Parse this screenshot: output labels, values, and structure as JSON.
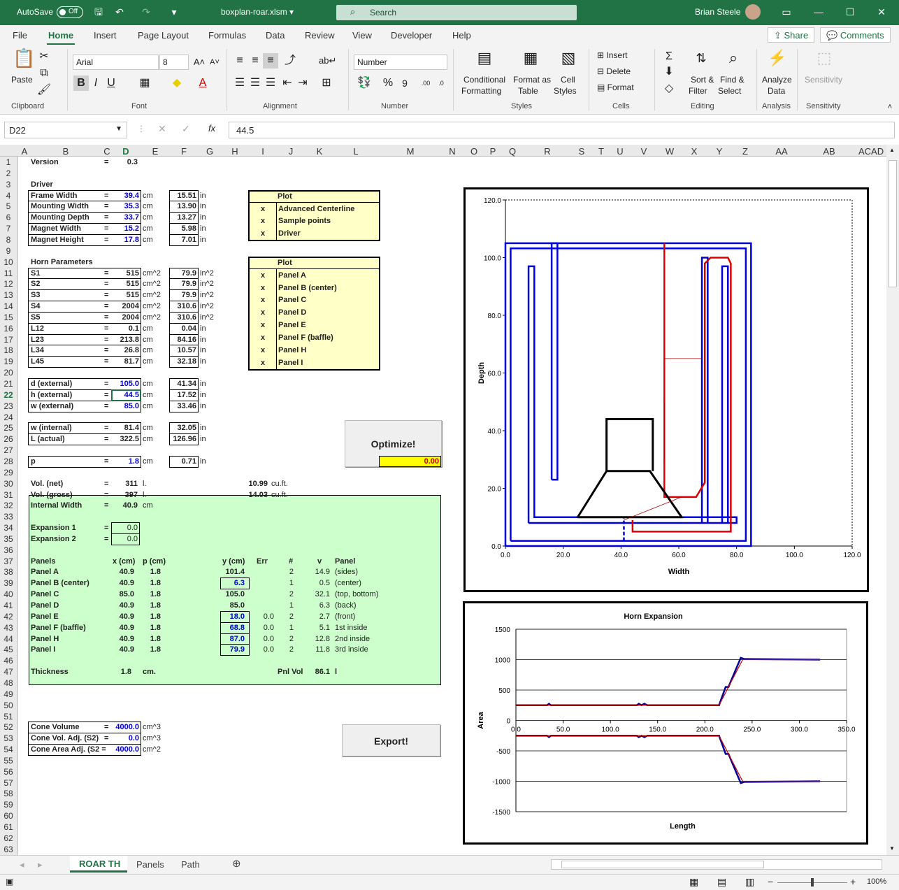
{
  "titlebar": {
    "autosave": "AutoSave",
    "autosave_state": "Off",
    "filename": "boxplan-roar.xlsm ▾",
    "search": "Search",
    "user": "Brian Steele"
  },
  "menu": {
    "tabs": [
      "File",
      "Home",
      "Insert",
      "Page Layout",
      "Formulas",
      "Data",
      "Review",
      "View",
      "Developer",
      "Help"
    ],
    "share": "Share",
    "comments": "Comments"
  },
  "ribbon": {
    "paste": "Paste",
    "font_name": "Arial",
    "font_size": "8",
    "number_format": "Number",
    "groups": [
      "Clipboard",
      "Font",
      "Alignment",
      "Number",
      "Styles",
      "Cells",
      "Editing",
      "Analysis",
      "Sensitivity"
    ],
    "conditional": "Conditional",
    "formatting": "Formatting",
    "format_as": "Format as",
    "table": "Table",
    "cell": "Cell",
    "styles": "Styles",
    "insert": "Insert",
    "delete": "Delete",
    "format": "Format",
    "sort_filter_1": "Sort &",
    "sort_filter_2": "Filter",
    "find_1": "Find &",
    "find_2": "Select",
    "analyze_1": "Analyze",
    "analyze_2": "Data",
    "sensitivity": "Sensitivity"
  },
  "formula_bar": {
    "name_box": "D22",
    "value": "44.5"
  },
  "columns": [
    "A",
    "B",
    "C",
    "D",
    "E",
    "F",
    "G",
    "H",
    "I",
    "J",
    "K",
    "L",
    "M",
    "N",
    "O",
    "P",
    "Q",
    "R",
    "S",
    "T",
    "U",
    "V",
    "W",
    "X",
    "Y",
    "Z",
    "AA",
    "AB",
    "ACAD"
  ],
  "rows": [
    "1",
    "2",
    "3",
    "4",
    "5",
    "6",
    "7",
    "8",
    "9",
    "10",
    "11",
    "12",
    "13",
    "14",
    "15",
    "16",
    "17",
    "18",
    "19",
    "20",
    "21",
    "22",
    "23",
    "24",
    "25",
    "26",
    "27",
    "28",
    "29",
    "30",
    "31",
    "32",
    "33",
    "34",
    "35",
    "36",
    "37",
    "38",
    "39",
    "40",
    "41",
    "42",
    "43",
    "44",
    "45",
    "46",
    "47",
    "48",
    "49",
    "50",
    "51",
    "52",
    "53",
    "54",
    "55",
    "56",
    "57",
    "58",
    "59",
    "60",
    "61",
    "62",
    "63"
  ],
  "sheet": {
    "version_label": "Version",
    "version_eq": "=",
    "version": "0.3",
    "driver": "Driver",
    "horn_params": "Horn Parameters",
    "params": [
      {
        "label": "Frame Width",
        "eq": "=",
        "v": "39.4",
        "u": "cm",
        "v2": "15.51",
        "u2": "in"
      },
      {
        "label": "Mounting Width",
        "eq": "=",
        "v": "35.3",
        "u": "cm",
        "v2": "13.90",
        "u2": "in"
      },
      {
        "label": "Mounting Depth",
        "eq": "=",
        "v": "33.7",
        "u": "cm",
        "v2": "13.27",
        "u2": "in"
      },
      {
        "label": "Magnet Width",
        "eq": "=",
        "v": "15.2",
        "u": "cm",
        "v2": "5.98",
        "u2": "in"
      },
      {
        "label": "Magnet Height",
        "eq": "=",
        "v": "17.8",
        "u": "cm",
        "v2": "7.01",
        "u2": "in"
      }
    ],
    "horn": [
      {
        "label": "S1",
        "eq": "=",
        "v": "515",
        "u": "cm^2",
        "v2": "79.9",
        "u2": "in^2"
      },
      {
        "label": "S2",
        "eq": "=",
        "v": "515",
        "u": "cm^2",
        "v2": "79.9",
        "u2": "in^2"
      },
      {
        "label": "S3",
        "eq": "=",
        "v": "515",
        "u": "cm^2",
        "v2": "79.9",
        "u2": "in^2"
      },
      {
        "label": "S4",
        "eq": "=",
        "v": "2004",
        "u": "cm^2",
        "v2": "310.6",
        "u2": "in^2"
      },
      {
        "label": "S5",
        "eq": "=",
        "v": "2004",
        "u": "cm^2",
        "v2": "310.6",
        "u2": "in^2"
      },
      {
        "label": "L12",
        "eq": "=",
        "v": "0.1",
        "u": "cm",
        "v2": "0.04",
        "u2": "in"
      },
      {
        "label": "L23",
        "eq": "=",
        "v": "213.8",
        "u": "cm",
        "v2": "84.16",
        "u2": "in"
      },
      {
        "label": "L34",
        "eq": "=",
        "v": "26.8",
        "u": "cm",
        "v2": "10.57",
        "u2": "in"
      },
      {
        "label": "L45",
        "eq": "=",
        "v": "81.7",
        "u": "cm",
        "v2": "32.18",
        "u2": "in"
      }
    ],
    "dims": [
      {
        "label": "d (external)",
        "eq": "=",
        "v": "105.0",
        "u": "cm",
        "v2": "41.34",
        "u2": "in"
      },
      {
        "label": "h (external)",
        "eq": "=",
        "v": "44.5",
        "u": "cm",
        "v2": "17.52",
        "u2": "in"
      },
      {
        "label": "w (external)",
        "eq": "=",
        "v": "85.0",
        "u": "cm",
        "v2": "33.46",
        "u2": "in"
      }
    ],
    "dims2": [
      {
        "label": "w (internal)",
        "eq": "=",
        "v": "81.4",
        "u": "cm",
        "v2": "32.05",
        "u2": "in"
      },
      {
        "label": "L (actual)",
        "eq": "=",
        "v": "322.5",
        "u": "cm",
        "v2": "126.96",
        "u2": "in"
      }
    ],
    "p": {
      "label": "p",
      "eq": "=",
      "v": "1.8",
      "u": "cm",
      "v2": "0.71",
      "u2": "in"
    },
    "plot1": {
      "title": "Plot",
      "items": [
        {
          "x": "x",
          "label": "Advanced Centerline"
        },
        {
          "x": "x",
          "label": "Sample points"
        },
        {
          "x": "x",
          "label": "Driver"
        }
      ]
    },
    "plot2": {
      "title": "Plot",
      "items": [
        {
          "x": "x",
          "label": "Panel A"
        },
        {
          "x": "x",
          "label": "Panel B (center)"
        },
        {
          "x": "x",
          "label": "Panel C"
        },
        {
          "x": "x",
          "label": "Panel D"
        },
        {
          "x": "x",
          "label": "Panel E"
        },
        {
          "x": "x",
          "label": "Panel F (baffle)"
        },
        {
          "x": "x",
          "label": "Panel H"
        },
        {
          "x": "x",
          "label": "Panel I"
        }
      ]
    },
    "optimize": "Optimize!",
    "export": "Export!",
    "yellow_value": "0.00",
    "vol_net": {
      "label": "Vol. (net)",
      "eq": "=",
      "v": "311",
      "u": "l.",
      "v2": "10.99",
      "u2": "cu.ft."
    },
    "vol_gross": {
      "label": "Vol. (gross)",
      "eq": "=",
      "v": "397",
      "u": "l.",
      "v2": "14.03",
      "u2": "cu.ft."
    },
    "internal_width": {
      "label": "Internal Width",
      "eq": "=",
      "v": "40.9",
      "u": "cm"
    },
    "expansion1": {
      "label": "Expansion 1",
      "eq": "=",
      "v": "0.0"
    },
    "expansion2": {
      "label": "Expansion 2",
      "eq": "=",
      "v": "0.0"
    },
    "panels_header": [
      "Panels",
      "x (cm)",
      "p (cm)",
      "y (cm)",
      "Err",
      "#",
      "v",
      "Panel"
    ],
    "panels": [
      [
        "Panel A",
        "40.9",
        "1.8",
        "101.4",
        "",
        "2",
        "14.9",
        "(sides)"
      ],
      [
        "Panel B (center)",
        "40.9",
        "1.8",
        "6.3",
        "",
        "1",
        "0.5",
        "(center)"
      ],
      [
        "Panel C",
        "85.0",
        "1.8",
        "105.0",
        "",
        "2",
        "32.1",
        "(top, bottom)"
      ],
      [
        "Panel D",
        "40.9",
        "1.8",
        "85.0",
        "",
        "1",
        "6.3",
        "(back)"
      ],
      [
        "Panel E",
        "40.9",
        "1.8",
        "18.0",
        "0.0",
        "2",
        "2.7",
        "(front)"
      ],
      [
        "Panel F (baffle)",
        "40.9",
        "1.8",
        "68.8",
        "0.0",
        "1",
        "5.1",
        "1st inside"
      ],
      [
        "Panel H",
        "40.9",
        "1.8",
        "87.0",
        "0.0",
        "2",
        "12.8",
        "2nd inside"
      ],
      [
        "Panel I",
        "40.9",
        "1.8",
        "79.9",
        "0.0",
        "2",
        "11.8",
        "3rd inside"
      ]
    ],
    "thickness": {
      "label": "Thickness",
      "v": "1.8",
      "u": "cm.",
      "label2": "Pnl Vol",
      "v2": "86.1",
      "u2": "l"
    },
    "cone": [
      {
        "label": "Cone Volume",
        "eq": "=",
        "v": "4000.0",
        "u": "cm^3"
      },
      {
        "label": "Cone Vol. Adj. (S2)",
        "eq": "=",
        "v": "0.0",
        "u": "cm^3"
      },
      {
        "label": "Cone Area Adj. (S2 =",
        "eq": "",
        "v": "4000.0",
        "u": "cm^2"
      }
    ]
  },
  "chart_data": [
    {
      "type": "line",
      "xlabel": "Width",
      "ylabel": "Depth",
      "xlim": [
        0,
        120
      ],
      "ylim": [
        0,
        120
      ],
      "xticks": [
        "0.0",
        "20.0",
        "40.0",
        "60.0",
        "80.0",
        "100.0",
        "120.0"
      ],
      "yticks": [
        "0.0",
        "20.0",
        "40.0",
        "60.0",
        "80.0",
        "100.0",
        "120.0"
      ],
      "series": [
        {
          "color": "#0000dd",
          "points": [
            [
              0,
              0
            ],
            [
              85,
              0
            ],
            [
              85,
              105
            ],
            [
              0,
              105
            ],
            [
              0,
              0
            ]
          ]
        },
        {
          "color": "#0000dd",
          "points": [
            [
              1.8,
              1.8
            ],
            [
              83.2,
              1.8
            ],
            [
              83.2,
              103.2
            ],
            [
              1.8,
              103.2
            ],
            [
              1.8,
              1.8
            ]
          ]
        },
        {
          "color": "#0000dd",
          "points": [
            [
              16,
              23
            ],
            [
              18,
              23
            ],
            [
              18,
              105
            ],
            [
              16,
              105
            ],
            [
              16,
              23
            ]
          ]
        },
        {
          "color": "#0000dd",
          "points": [
            [
              8,
              8
            ],
            [
              80,
              8
            ],
            [
              80,
              10
            ],
            [
              10,
              10
            ],
            [
              10,
              97
            ],
            [
              8,
              97
            ],
            [
              8,
              8
            ]
          ]
        },
        {
          "color": "#0000dd",
          "points": [
            [
              68,
              8
            ],
            [
              68,
              100
            ],
            [
              70,
              100
            ],
            [
              70,
              8
            ]
          ]
        },
        {
          "color": "#0000dd",
          "points": [
            [
              75,
              8
            ],
            [
              75,
              97
            ],
            [
              77,
              97
            ],
            [
              77,
              8
            ]
          ]
        },
        {
          "color": "#0000dd",
          "points": [
            [
              41,
              1.8
            ],
            [
              41,
              10
            ]
          ]
        },
        {
          "color": "#dd0000",
          "points": [
            [
              55,
              105
            ],
            [
              55,
              17
            ],
            [
              66,
              17
            ],
            [
              69,
              22
            ],
            [
              69,
              98
            ],
            [
              71,
              100
            ],
            [
              77,
              100
            ],
            [
              78,
              98
            ],
            [
              78,
              5
            ],
            [
              44,
              5
            ],
            [
              44,
              9
            ]
          ]
        },
        {
          "color": "#000000",
          "points": [
            [
              25,
              10
            ],
            [
              35,
              26
            ],
            [
              50,
              26
            ],
            [
              61,
              10
            ],
            [
              25,
              10
            ]
          ]
        },
        {
          "color": "#000000",
          "points": [
            [
              35,
              26
            ],
            [
              35,
              44
            ],
            [
              51,
              44
            ],
            [
              51,
              26
            ]
          ]
        }
      ]
    },
    {
      "type": "line",
      "title": "Horn Expansion",
      "xlabel": "Length",
      "ylabel": "Area",
      "xlim": [
        0,
        350
      ],
      "ylim": [
        -1500,
        1500
      ],
      "xticks": [
        "0.0",
        "50.0",
        "100.0",
        "150.0",
        "200.0",
        "250.0",
        "300.0",
        "350.0"
      ],
      "yticks": [
        "1500",
        "1000",
        "500",
        "0",
        "-500",
        "-1000",
        "-1500"
      ],
      "series": [
        {
          "color": "#000099",
          "values": [
            [
              0,
              250
            ],
            [
              33,
              250
            ],
            [
              35,
              275
            ],
            [
              37,
              250
            ],
            [
              128,
              250
            ],
            [
              130,
              275
            ],
            [
              133,
              250
            ],
            [
              136,
              275
            ],
            [
              139,
              250
            ],
            [
              215,
              250
            ],
            [
              222,
              550
            ],
            [
              225,
              550
            ],
            [
              238,
              1030
            ],
            [
              242,
              1010
            ],
            [
              322,
              1000
            ]
          ]
        },
        {
          "color": "#cc0000",
          "values": [
            [
              0,
              250
            ],
            [
              215,
              250
            ],
            [
              240,
              1000
            ],
            [
              322,
              1000
            ]
          ]
        },
        {
          "color": "#000099",
          "values": [
            [
              0,
              -250
            ],
            [
              33,
              -250
            ],
            [
              35,
              -275
            ],
            [
              37,
              -250
            ],
            [
              128,
              -250
            ],
            [
              130,
              -275
            ],
            [
              133,
              -250
            ],
            [
              136,
              -275
            ],
            [
              139,
              -250
            ],
            [
              215,
              -250
            ],
            [
              222,
              -550
            ],
            [
              225,
              -550
            ],
            [
              238,
              -1030
            ],
            [
              242,
              -1010
            ],
            [
              322,
              -1000
            ]
          ]
        },
        {
          "color": "#cc0000",
          "values": [
            [
              0,
              -250
            ],
            [
              215,
              -250
            ],
            [
              240,
              -1000
            ],
            [
              322,
              -1000
            ]
          ]
        }
      ]
    }
  ],
  "sheet_tabs": [
    "ROAR TH",
    "Panels",
    "Path"
  ],
  "status": {
    "zoom": "100%"
  }
}
